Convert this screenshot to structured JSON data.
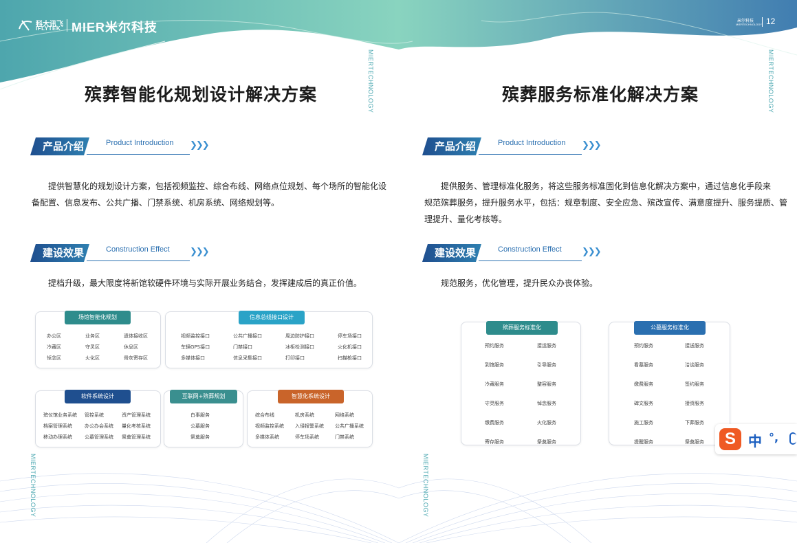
{
  "header": {
    "logo_cn": "科大讯飞",
    "logo_en": "IFLYTEK",
    "brand": "MIER米尔科技",
    "page_brand_cn": "米尔科技",
    "page_brand_en": "MIERTECHNOLOGY",
    "page_number": "12"
  },
  "side_label": "MIERTECHNOLOGY",
  "left": {
    "title": "殡葬智能化规划设计解决方案",
    "sec1": {
      "cn": "产品介绍",
      "en": "Product Introduction"
    },
    "intro_line1": "提供智慧化的规划设计方案，包括视频监控、综合布线、网络点位规划、每个场所的智能化设",
    "intro_line2": "备配置、信息发布、公共广播、门禁系统、机房系统、网络规划等。",
    "sec2": {
      "cn": "建设效果",
      "en": "Construction Effect"
    },
    "effect": "提档升级，最大限度将新馆软硬件环境与实际开展业务结合，发挥建成后的真正价值。",
    "cards": {
      "c1": {
        "title": "场馆智能化规划",
        "items": [
          "办公区",
          "业务区",
          "遗体接收区",
          "冷藏区",
          "守灵区",
          "休息区",
          "悼念区",
          "火化区",
          "骨灰寄存区"
        ]
      },
      "c2": {
        "title": "信息总线接口设计",
        "items": [
          "视频监控接口",
          "公共广播接口",
          "周边防护接口",
          "停车场接口",
          "车辆GPS接口",
          "门禁接口",
          "冰柜检测接口",
          "火化机接口",
          "多媒体接口",
          "信息采集接口",
          "打印接口",
          "扫描枪接口"
        ]
      },
      "c3": {
        "title": "软件系统设计",
        "items": [
          "殡仪馆业务系统",
          "管控系统",
          "资产管理系统",
          "档案管理系统",
          "办公办会系统",
          "量化考核系统",
          "移动办理系统",
          "公墓管理系统",
          "祭奠管理系统"
        ]
      },
      "c4": {
        "title": "互联网+殡葬规划",
        "items": [
          "白事服务",
          "公墓服务",
          "祭奠服务"
        ]
      },
      "c5": {
        "title": "智慧化系统设计",
        "items": [
          "综合布线",
          "机房系统",
          "网络系统",
          "视频监控系统",
          "入侵报警系统",
          "公共广播系统",
          "多媒体系统",
          "停车场系统",
          "门禁系统"
        ]
      }
    }
  },
  "right": {
    "title": "殡葬服务标准化解决方案",
    "sec1": {
      "cn": "产品介绍",
      "en": "Product Introduction"
    },
    "intro_line1": "提供服务、管理标准化服务，将这些服务标准固化到信息化解决方案中，通过信息化手段来",
    "intro_line2": "规范殡葬服务，提升服务水平，包括：规章制度、安全应急、殡改宣传、满意度提升、服务提质、管",
    "intro_line3": "理提升、量化考核等。",
    "sec2": {
      "cn": "建设效果",
      "en": "Construction Effect"
    },
    "effect": "规范服务，优化管理，提升民众办丧体验。",
    "cards": {
      "c1": {
        "title": "殡葬服务标准化",
        "items": [
          "预约服务",
          "接运服务",
          "到馆服务",
          "引导服务",
          "冷藏服务",
          "整容服务",
          "守灵服务",
          "悼念服务",
          "缴费服务",
          "火化服务",
          "寄存服务",
          "祭奠服务"
        ]
      },
      "c2": {
        "title": "公墓服务标准化",
        "items": [
          "预约服务",
          "接送服务",
          "看墓服务",
          "洽谈服务",
          "缴费服务",
          "签约服务",
          "碑文服务",
          "接资服务",
          "施工服务",
          "下葬服务",
          "提醒服务",
          "祭奠服务"
        ]
      }
    }
  },
  "ime": {
    "char": "中",
    "punct": "°,"
  },
  "colors": {
    "teal": "#2e8c8c",
    "navy": "#1f4f8f",
    "cyan": "#2aa3c7",
    "orange": "#c9642a",
    "accent": "#2a6fb0"
  }
}
